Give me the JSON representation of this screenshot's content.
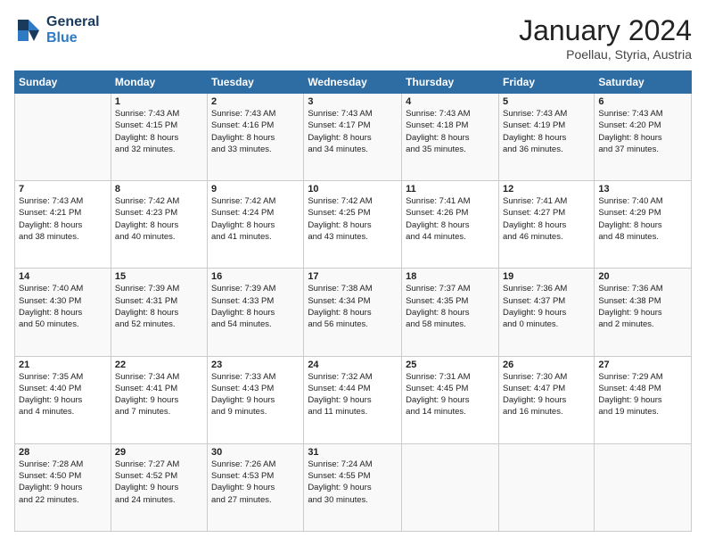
{
  "header": {
    "logo_line1": "General",
    "logo_line2": "Blue",
    "main_title": "January 2024",
    "subtitle": "Poellau, Styria, Austria"
  },
  "days_of_week": [
    "Sunday",
    "Monday",
    "Tuesday",
    "Wednesday",
    "Thursday",
    "Friday",
    "Saturday"
  ],
  "weeks": [
    [
      {
        "day": "",
        "content": ""
      },
      {
        "day": "1",
        "content": "Sunrise: 7:43 AM\nSunset: 4:15 PM\nDaylight: 8 hours\nand 32 minutes."
      },
      {
        "day": "2",
        "content": "Sunrise: 7:43 AM\nSunset: 4:16 PM\nDaylight: 8 hours\nand 33 minutes."
      },
      {
        "day": "3",
        "content": "Sunrise: 7:43 AM\nSunset: 4:17 PM\nDaylight: 8 hours\nand 34 minutes."
      },
      {
        "day": "4",
        "content": "Sunrise: 7:43 AM\nSunset: 4:18 PM\nDaylight: 8 hours\nand 35 minutes."
      },
      {
        "day": "5",
        "content": "Sunrise: 7:43 AM\nSunset: 4:19 PM\nDaylight: 8 hours\nand 36 minutes."
      },
      {
        "day": "6",
        "content": "Sunrise: 7:43 AM\nSunset: 4:20 PM\nDaylight: 8 hours\nand 37 minutes."
      }
    ],
    [
      {
        "day": "7",
        "content": "Sunrise: 7:43 AM\nSunset: 4:21 PM\nDaylight: 8 hours\nand 38 minutes."
      },
      {
        "day": "8",
        "content": "Sunrise: 7:42 AM\nSunset: 4:23 PM\nDaylight: 8 hours\nand 40 minutes."
      },
      {
        "day": "9",
        "content": "Sunrise: 7:42 AM\nSunset: 4:24 PM\nDaylight: 8 hours\nand 41 minutes."
      },
      {
        "day": "10",
        "content": "Sunrise: 7:42 AM\nSunset: 4:25 PM\nDaylight: 8 hours\nand 43 minutes."
      },
      {
        "day": "11",
        "content": "Sunrise: 7:41 AM\nSunset: 4:26 PM\nDaylight: 8 hours\nand 44 minutes."
      },
      {
        "day": "12",
        "content": "Sunrise: 7:41 AM\nSunset: 4:27 PM\nDaylight: 8 hours\nand 46 minutes."
      },
      {
        "day": "13",
        "content": "Sunrise: 7:40 AM\nSunset: 4:29 PM\nDaylight: 8 hours\nand 48 minutes."
      }
    ],
    [
      {
        "day": "14",
        "content": "Sunrise: 7:40 AM\nSunset: 4:30 PM\nDaylight: 8 hours\nand 50 minutes."
      },
      {
        "day": "15",
        "content": "Sunrise: 7:39 AM\nSunset: 4:31 PM\nDaylight: 8 hours\nand 52 minutes."
      },
      {
        "day": "16",
        "content": "Sunrise: 7:39 AM\nSunset: 4:33 PM\nDaylight: 8 hours\nand 54 minutes."
      },
      {
        "day": "17",
        "content": "Sunrise: 7:38 AM\nSunset: 4:34 PM\nDaylight: 8 hours\nand 56 minutes."
      },
      {
        "day": "18",
        "content": "Sunrise: 7:37 AM\nSunset: 4:35 PM\nDaylight: 8 hours\nand 58 minutes."
      },
      {
        "day": "19",
        "content": "Sunrise: 7:36 AM\nSunset: 4:37 PM\nDaylight: 9 hours\nand 0 minutes."
      },
      {
        "day": "20",
        "content": "Sunrise: 7:36 AM\nSunset: 4:38 PM\nDaylight: 9 hours\nand 2 minutes."
      }
    ],
    [
      {
        "day": "21",
        "content": "Sunrise: 7:35 AM\nSunset: 4:40 PM\nDaylight: 9 hours\nand 4 minutes."
      },
      {
        "day": "22",
        "content": "Sunrise: 7:34 AM\nSunset: 4:41 PM\nDaylight: 9 hours\nand 7 minutes."
      },
      {
        "day": "23",
        "content": "Sunrise: 7:33 AM\nSunset: 4:43 PM\nDaylight: 9 hours\nand 9 minutes."
      },
      {
        "day": "24",
        "content": "Sunrise: 7:32 AM\nSunset: 4:44 PM\nDaylight: 9 hours\nand 11 minutes."
      },
      {
        "day": "25",
        "content": "Sunrise: 7:31 AM\nSunset: 4:45 PM\nDaylight: 9 hours\nand 14 minutes."
      },
      {
        "day": "26",
        "content": "Sunrise: 7:30 AM\nSunset: 4:47 PM\nDaylight: 9 hours\nand 16 minutes."
      },
      {
        "day": "27",
        "content": "Sunrise: 7:29 AM\nSunset: 4:48 PM\nDaylight: 9 hours\nand 19 minutes."
      }
    ],
    [
      {
        "day": "28",
        "content": "Sunrise: 7:28 AM\nSunset: 4:50 PM\nDaylight: 9 hours\nand 22 minutes."
      },
      {
        "day": "29",
        "content": "Sunrise: 7:27 AM\nSunset: 4:52 PM\nDaylight: 9 hours\nand 24 minutes."
      },
      {
        "day": "30",
        "content": "Sunrise: 7:26 AM\nSunset: 4:53 PM\nDaylight: 9 hours\nand 27 minutes."
      },
      {
        "day": "31",
        "content": "Sunrise: 7:24 AM\nSunset: 4:55 PM\nDaylight: 9 hours\nand 30 minutes."
      },
      {
        "day": "",
        "content": ""
      },
      {
        "day": "",
        "content": ""
      },
      {
        "day": "",
        "content": ""
      }
    ]
  ]
}
